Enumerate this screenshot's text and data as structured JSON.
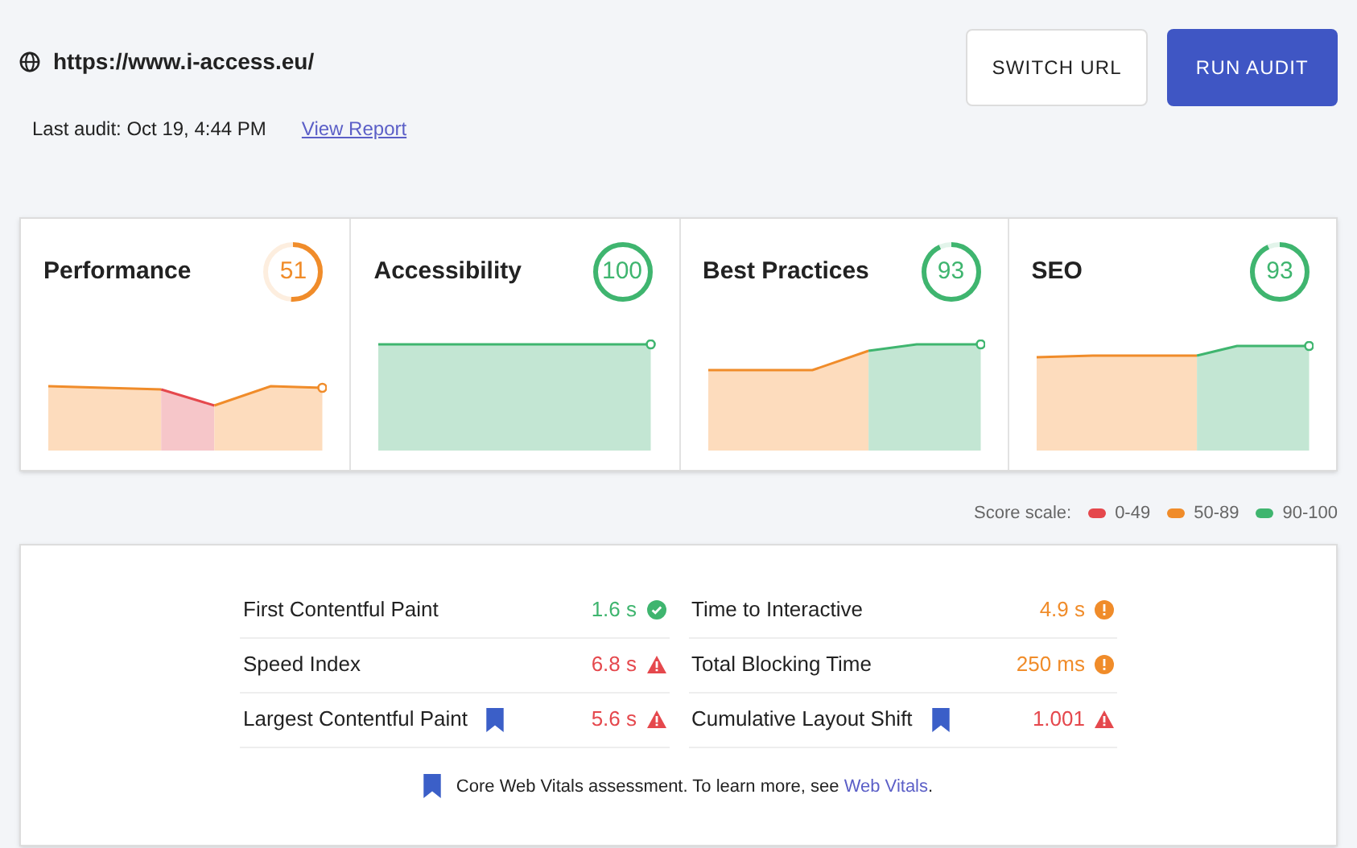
{
  "header": {
    "url": "https://www.i-access.eu/",
    "last_audit": "Last audit: Oct 19, 4:44 PM",
    "report_link": "View Report",
    "buttons": [
      {
        "label": "SWITCH URL",
        "kind": "secondary"
      },
      {
        "label": "RUN AUDIT",
        "kind": "primary"
      }
    ]
  },
  "categories": [
    {
      "title": "Performance",
      "score": "51",
      "level": 0.51,
      "color": "#f08c2a"
    },
    {
      "title": "Accessibility",
      "score": "100",
      "level": 1,
      "color": "#3fb56f"
    },
    {
      "title": "Best Practices",
      "score": "93",
      "level": 0.93,
      "color": "#3fb56f"
    },
    {
      "title": "SEO",
      "score": "93",
      "level": 0.93,
      "color": "#3fb56f"
    }
  ],
  "score_scale": {
    "label": "Score scale:",
    "ranges": [
      {
        "label": "0-49",
        "color": "#e5484d"
      },
      {
        "label": "50-89",
        "color": "#f08c2a"
      },
      {
        "label": "90-100",
        "color": "#3fb56f"
      }
    ]
  },
  "metrics": [
    {
      "name": "First Contentful Paint",
      "value": "1.6 s",
      "kind": "pass",
      "color": "#3fb56f",
      "core_vital": false
    },
    {
      "name": "Time to Interactive",
      "value": "4.9 s",
      "kind": "average",
      "color": "#f08c2a",
      "core_vital": false
    },
    {
      "name": "Speed Index",
      "value": "6.8 s",
      "kind": "fail",
      "color": "#e5484d",
      "core_vital": false
    },
    {
      "name": "Total Blocking Time",
      "value": "250 ms",
      "kind": "average",
      "color": "#f08c2a",
      "core_vital": false
    },
    {
      "name": "Largest Contentful Paint",
      "value": "5.6 s",
      "kind": "fail",
      "color": "#e5484d",
      "core_vital": true
    },
    {
      "name": "Cumulative Layout Shift",
      "value": "1.001",
      "kind": "fail",
      "color": "#e5484d",
      "core_vital": true
    }
  ],
  "note": {
    "text": "Core Web Vitals assessment. To learn more, see",
    "link": "Web Vitals",
    "end": "."
  }
}
